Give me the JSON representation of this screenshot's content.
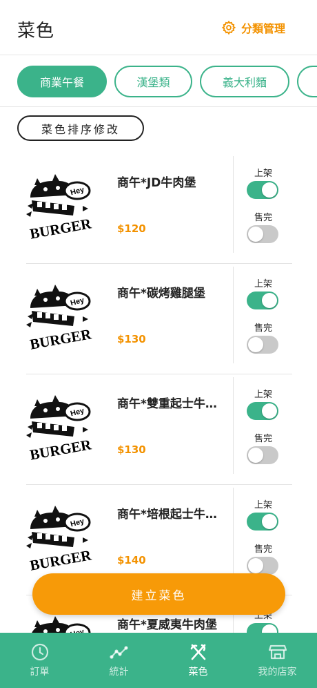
{
  "header": {
    "title": "菜色",
    "category_manage_label": "分類管理",
    "accent_color": "#f39200"
  },
  "categories": [
    {
      "label": "商業午餐",
      "active": true
    },
    {
      "label": "漢堡類",
      "active": false
    },
    {
      "label": "義大利麵",
      "active": false
    },
    {
      "label": "",
      "active": false
    }
  ],
  "sort_button_label": "菜色排序修改",
  "list_labels": {
    "on_shelf": "上架",
    "sold_out": "售完"
  },
  "dishes": [
    {
      "name": "商午*JD牛肉堡",
      "price": "$120",
      "on_shelf": true,
      "sold_out": false
    },
    {
      "name": "商午*碳烤雞腿堡",
      "price": "$130",
      "on_shelf": true,
      "sold_out": false
    },
    {
      "name": "商午*雙重起士牛…",
      "price": "$130",
      "on_shelf": true,
      "sold_out": false
    },
    {
      "name": "商午*培根起士牛…",
      "price": "$140",
      "on_shelf": true,
      "sold_out": false
    },
    {
      "name": "商午*夏威夷牛肉堡",
      "price": "",
      "on_shelf": true,
      "sold_out": false
    }
  ],
  "thumbnail_logo": {
    "top_text": "Hey",
    "main_text": "BURGER"
  },
  "create_button_label": "建立菜色",
  "bottom_nav": [
    {
      "label": "訂單",
      "icon": "clock-icon",
      "active": false
    },
    {
      "label": "統計",
      "icon": "chart-line-icon",
      "active": false
    },
    {
      "label": "菜色",
      "icon": "utensils-icon",
      "active": true
    },
    {
      "label": "我的店家",
      "icon": "store-icon",
      "active": false
    }
  ],
  "colors": {
    "primary": "#3bb38a",
    "orange": "#f39200",
    "toggle_off": "#c9c9c9"
  }
}
